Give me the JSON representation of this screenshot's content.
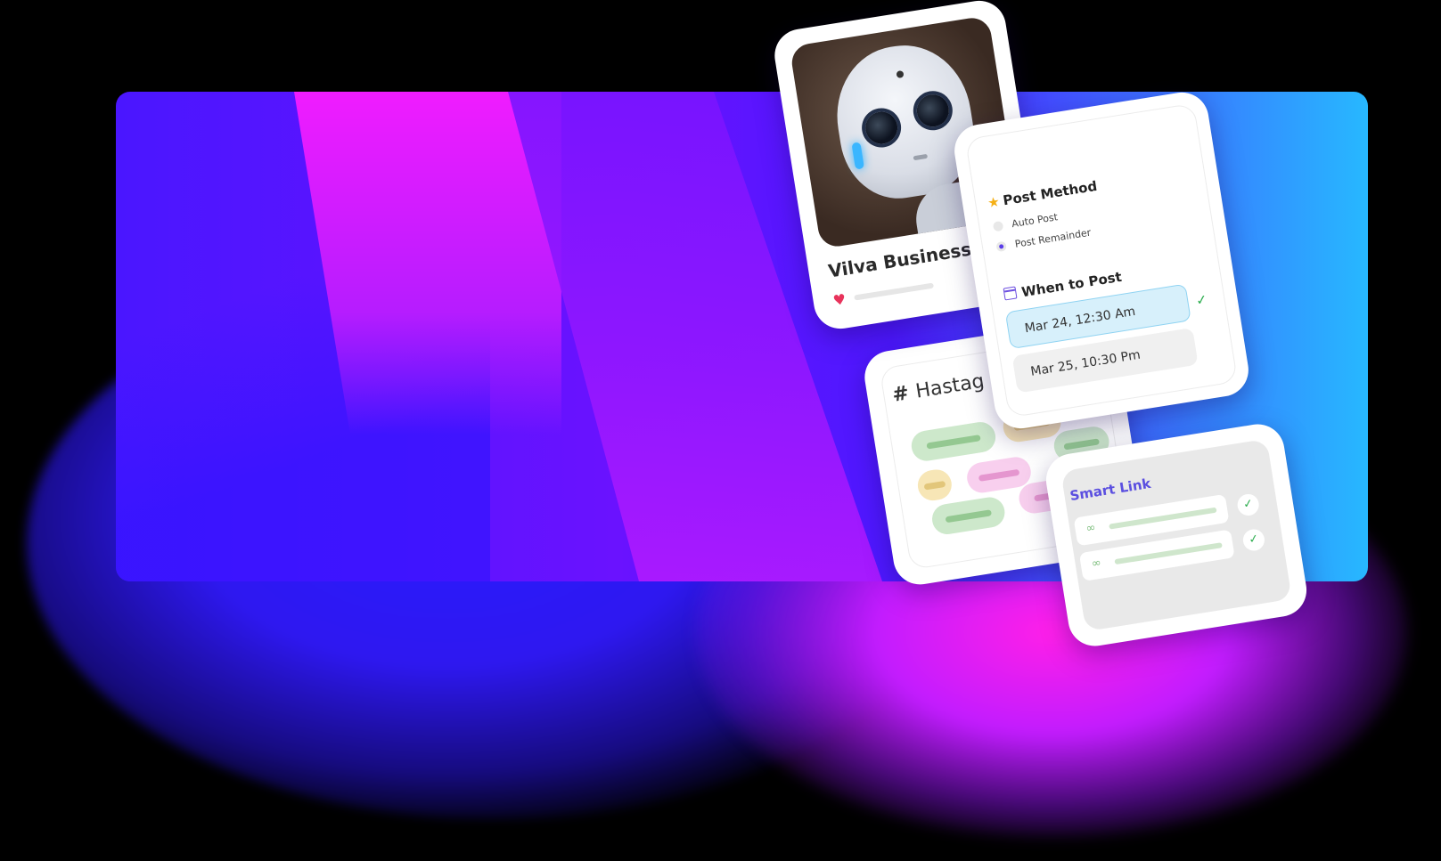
{
  "profile": {
    "name": "Vilva Business",
    "photo_alt": "robot-photo",
    "heart_icon": "heart-icon"
  },
  "post_method": {
    "title": "Post Method",
    "options": [
      {
        "label": "Auto Post",
        "selected": false
      },
      {
        "label": "Post Remainder",
        "selected": true
      }
    ]
  },
  "when_to_post": {
    "title": "When to Post",
    "dates": [
      {
        "label": "Mar 24, 12:30 Am",
        "selected": true
      },
      {
        "label": "Mar 25, 10:30 Pm",
        "selected": false
      }
    ]
  },
  "hashtag": {
    "hash": "#",
    "title": "Hastag F"
  },
  "smart_link": {
    "title": "Smart Link"
  },
  "colors": {
    "accent_purple": "#5b4fe0",
    "check_green": "#2fae51",
    "selected_bg": "#d7f0fb"
  }
}
